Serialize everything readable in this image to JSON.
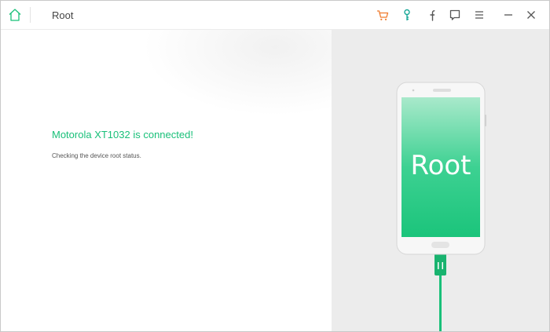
{
  "window": {
    "title": "Root"
  },
  "toolbar": {
    "icons": [
      "home-icon",
      "cart-icon",
      "key-icon",
      "facebook-icon",
      "feedback-icon",
      "menu-icon",
      "minimize-icon",
      "close-icon"
    ]
  },
  "status": {
    "heading": "Motorola XT1032 is connected!",
    "message": "Checking the device root status."
  },
  "phone": {
    "screen_text": "Root"
  },
  "colors": {
    "accent": "#19c079",
    "cart": "#f07a2c",
    "key": "#1aa898",
    "panel": "#ececec"
  }
}
